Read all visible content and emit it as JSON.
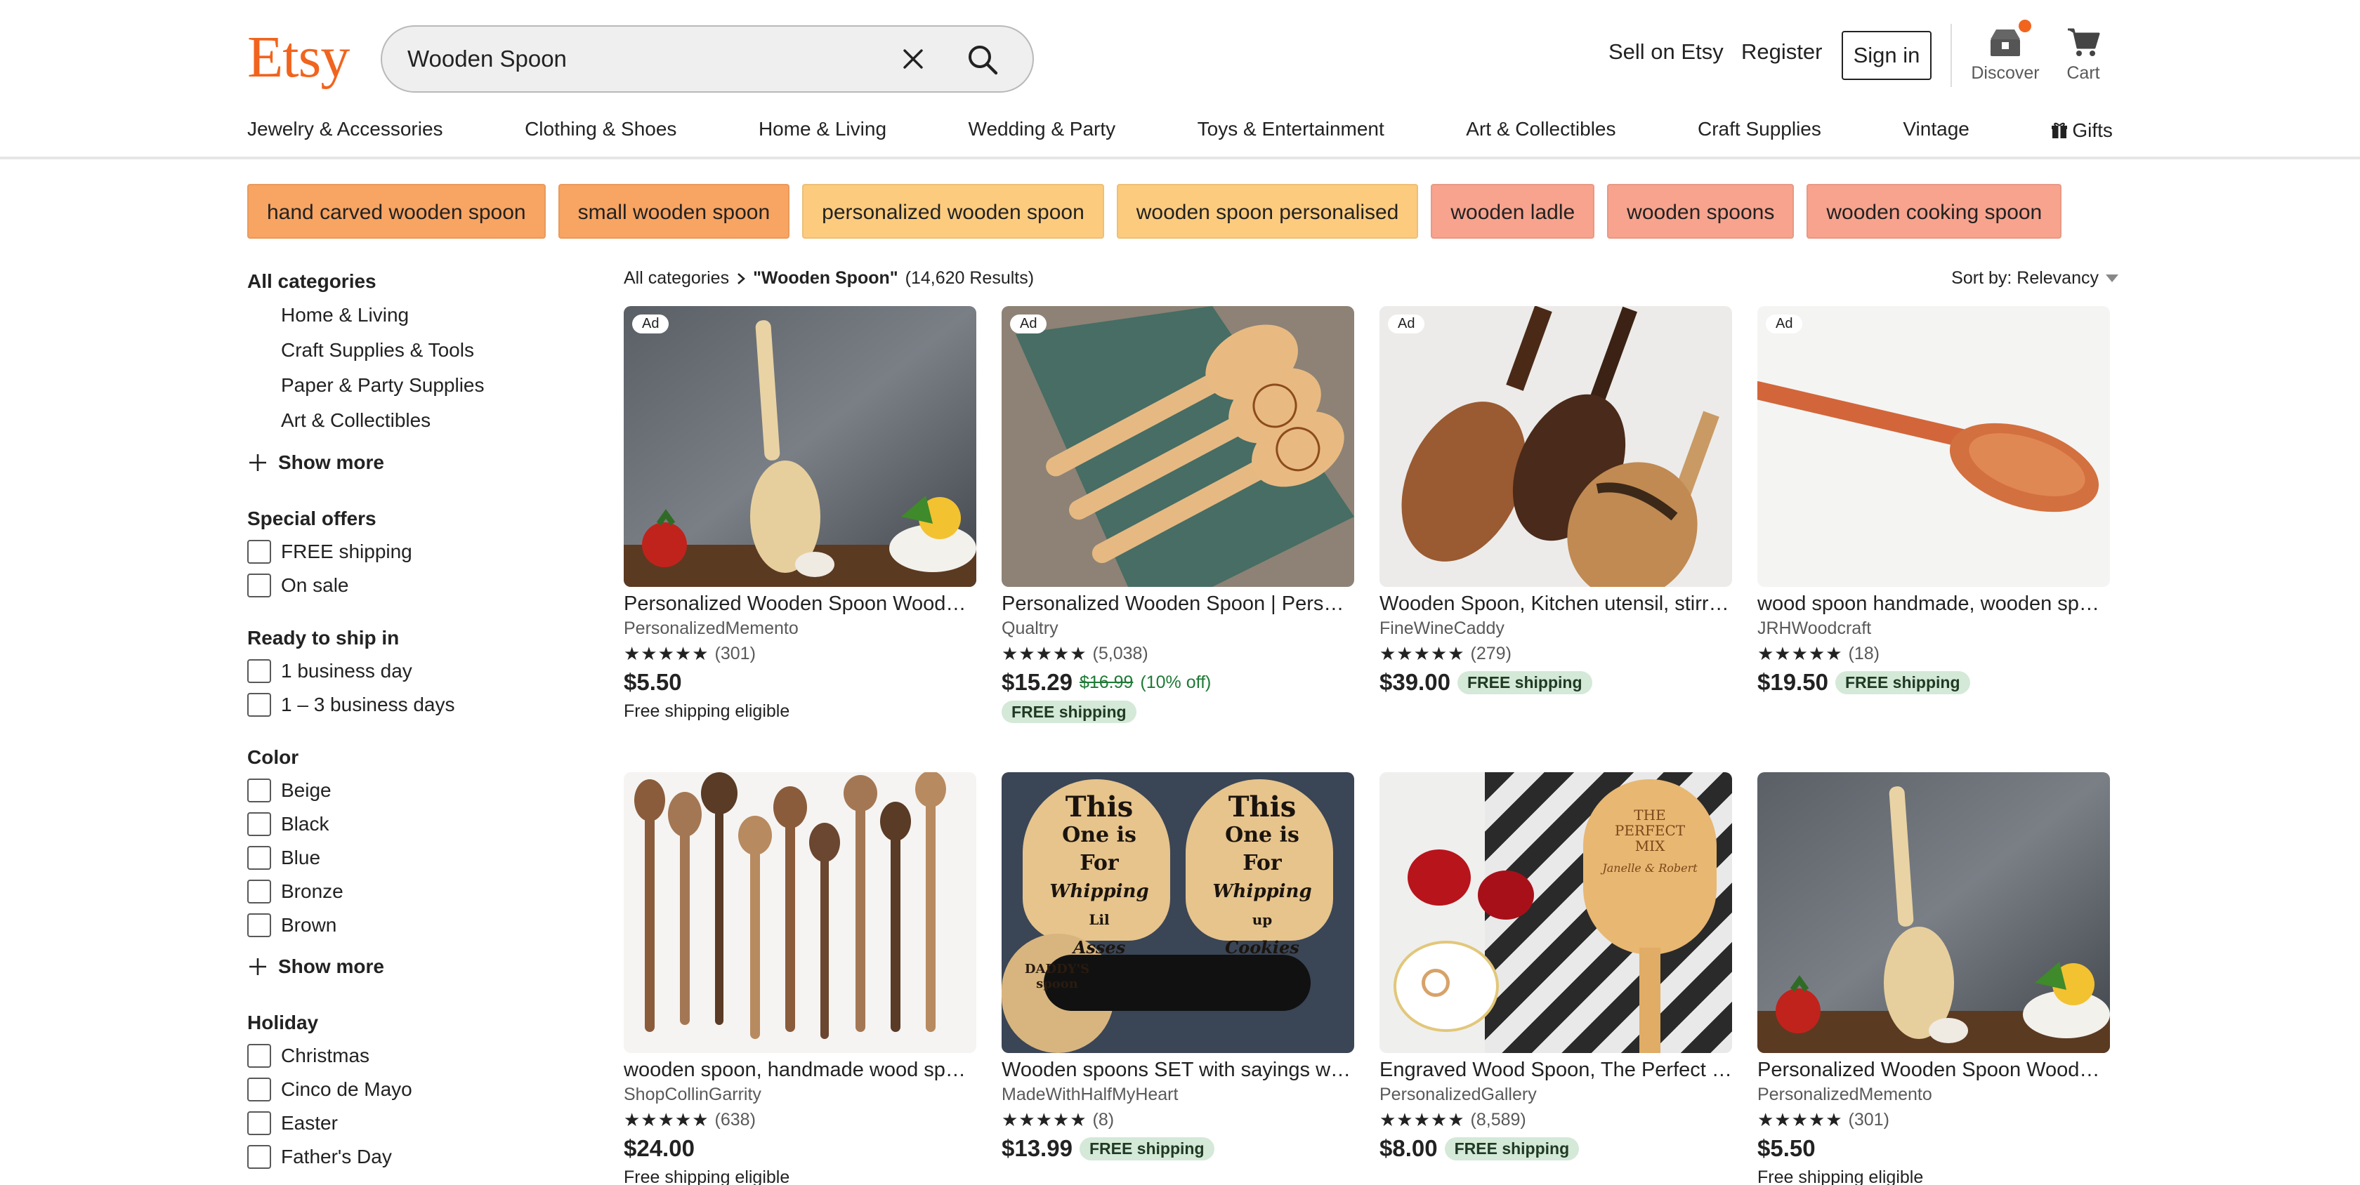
{
  "header": {
    "logo": "Etsy",
    "search_value": "Wooden Spoon",
    "sell": "Sell on Etsy",
    "register": "Register",
    "signin": "Sign in",
    "discover": "Discover",
    "cart": "Cart"
  },
  "categories": [
    "Jewelry & Accessories",
    "Clothing & Shoes",
    "Home & Living",
    "Wedding & Party",
    "Toys & Entertainment",
    "Art & Collectibles",
    "Craft Supplies",
    "Vintage",
    "Gifts"
  ],
  "chips": [
    {
      "label": "hand carved wooden spoon",
      "color": "#F8A462"
    },
    {
      "label": "small wooden spoon",
      "color": "#F8A462"
    },
    {
      "label": "personalized wooden spoon",
      "color": "#FCCB7E"
    },
    {
      "label": "wooden spoon personalised",
      "color": "#FCCB7E"
    },
    {
      "label": "wooden ladle",
      "color": "#F7A38E"
    },
    {
      "label": "wooden spoons",
      "color": "#F7A38E"
    },
    {
      "label": "wooden cooking spoon",
      "color": "#F7A38E"
    }
  ],
  "sidebar": {
    "all_categories": "All categories",
    "category_links": [
      "Home & Living",
      "Craft Supplies & Tools",
      "Paper & Party Supplies",
      "Art & Collectibles"
    ],
    "show_more": "Show more",
    "special_offers": {
      "title": "Special offers",
      "options": [
        "FREE shipping",
        "On sale"
      ]
    },
    "ready_to_ship": {
      "title": "Ready to ship in",
      "options": [
        "1 business day",
        "1 – 3 business days"
      ]
    },
    "color": {
      "title": "Color",
      "options": [
        "Beige",
        "Black",
        "Blue",
        "Bronze",
        "Brown"
      ]
    },
    "holiday": {
      "title": "Holiday",
      "options": [
        "Christmas",
        "Cinco de Mayo",
        "Easter",
        "Father's Day"
      ]
    }
  },
  "results": {
    "crumb_all": "All categories",
    "query": "\"Wooden Spoon\"",
    "count": "(14,620 Results)",
    "sort": "Sort by: Relevancy"
  },
  "stars": "★★★★★",
  "listings": [
    {
      "title": "Personalized Wooden Spoon Wooden Spoon Gift",
      "shop": "PersonalizedMemento",
      "reviews": "(301)",
      "price": "$5.50",
      "ad": "Ad",
      "extra": "Free shipping eligible",
      "img": "spoon-slate"
    },
    {
      "title": "Personalized Wooden Spoon | Personalized Gift",
      "shop": "Qualtry",
      "reviews": "(5,038)",
      "price": "$15.29",
      "old_price": "$16.99",
      "discount": "(10% off)",
      "free": "FREE shipping",
      "ad": "Ad",
      "img": "spoon-engraved"
    },
    {
      "title": "Wooden Spoon, Kitchen utensil, stirring spoon",
      "shop": "FineWineCaddy",
      "reviews": "(279)",
      "price": "$39.00",
      "free": "FREE shipping",
      "ad": "Ad",
      "img": "spoon-walnut"
    },
    {
      "title": "wood spoon handmade, wooden spoon cherry",
      "shop": "JRHWoodcraft",
      "reviews": "(18)",
      "price": "$19.50",
      "free": "FREE shipping",
      "ad": "Ad",
      "img": "spoon-cherry"
    },
    {
      "title": "wooden spoon, handmade wood spoon set",
      "shop": "ShopCollinGarrity",
      "reviews": "(638)",
      "price": "$24.00",
      "extra": "Free shipping eligible",
      "img": "spoon-many"
    },
    {
      "title": "Wooden spoons SET with sayings whipping",
      "shop": "MadeWithHalfMyHeart",
      "reviews": "(8)",
      "price": "$13.99",
      "free": "FREE shipping",
      "img": "spoon-sayings"
    },
    {
      "title": "Engraved Wood Spoon, The Perfect Mix",
      "shop": "PersonalizedGallery",
      "reviews": "(8,589)",
      "price": "$8.00",
      "free": "FREE shipping",
      "img": "spoon-rose"
    },
    {
      "title": "Personalized Wooden Spoon Wooden Spoon Gift",
      "shop": "PersonalizedMemento",
      "reviews": "(301)",
      "price": "$5.50",
      "extra": "Free shipping eligible",
      "img": "spoon-slate"
    }
  ],
  "spoon_sayings": {
    "line1": "This",
    "line2": "One is For",
    "left": "Whipping",
    "left2": "Lil",
    "left3": "Asses",
    "right": "Whipping",
    "right2": "up",
    "right3": "Cookies",
    "tag": "DADDY'S spoon"
  },
  "spoon_rose_text": {
    "l1": "THE",
    "l2": "PERFECT",
    "l3": "MIX",
    "l4": "Janelle & Robert"
  },
  "colors": {
    "brand": "#F1641E",
    "free_badge": "#D4E9D7",
    "discount": "#1F7A36"
  }
}
